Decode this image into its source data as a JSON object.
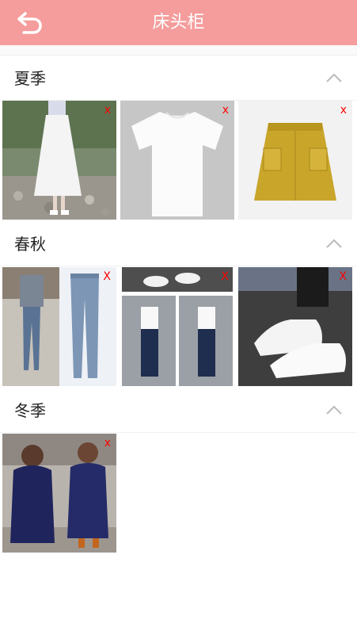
{
  "header": {
    "title": "床头柜",
    "back_icon": "back-arrow-icon",
    "color": "#f59c9c"
  },
  "sections": [
    {
      "title": "夏季",
      "items": [
        {
          "name": "white-tulle-skirt-photo",
          "delete_label": "x"
        },
        {
          "name": "white-tshirt-photo",
          "delete_label": "x"
        },
        {
          "name": "yellow-corduroy-skirt-photo",
          "delete_label": "x"
        }
      ]
    },
    {
      "title": "春秋",
      "items": [
        {
          "name": "blue-jeans-photo",
          "delete_label": "X"
        },
        {
          "name": "track-pants-photo",
          "delete_label": "X"
        },
        {
          "name": "white-sneakers-photo",
          "delete_label": "X"
        }
      ]
    },
    {
      "title": "冬季",
      "items": [
        {
          "name": "navy-velvet-coat-photo",
          "delete_label": "x"
        }
      ]
    }
  ],
  "delete_color": "#ff0000"
}
